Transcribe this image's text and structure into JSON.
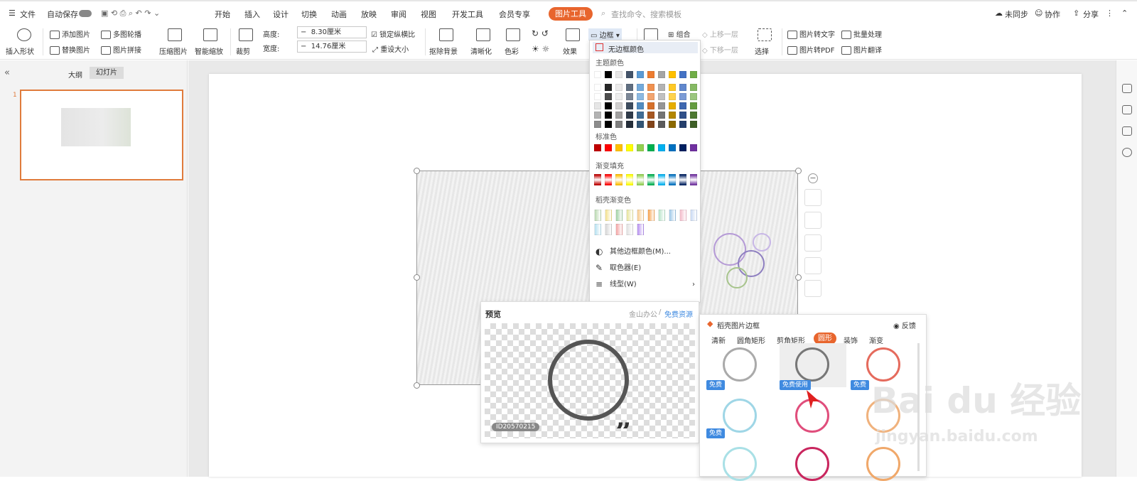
{
  "menu": {
    "file": "文件",
    "autosave": "自动保存"
  },
  "tabs": [
    "开始",
    "插入",
    "设计",
    "切换",
    "动画",
    "放映",
    "审阅",
    "视图",
    "开发工具",
    "会员专享"
  ],
  "active_tab": "图片工具",
  "search_placeholder": "查找命令、搜索模板",
  "top_right": {
    "sync": "未同步",
    "collab": "协作",
    "share": "分享"
  },
  "ribbon": {
    "insert_shape": "插入形状",
    "add_picture": "添加图片",
    "replace_picture": "替换图片",
    "multi_carousel": "多图轮播",
    "picture_collage": "图片拼接",
    "compress": "压缩图片",
    "smart_zoom": "智能缩放",
    "crop": "裁剪",
    "height_label": "高度:",
    "height_value": "8.30厘米",
    "width_label": "宽度:",
    "width_value": "14.76厘米",
    "lock_ratio": "锁定纵横比",
    "reset_size": "重设大小",
    "remove_bg": "抠除背景",
    "sharpen": "清晰化",
    "color": "色彩",
    "effect": "效果",
    "border": "边框",
    "group": "组合",
    "bring_forward": "上移一层",
    "send_backward": "下移一层",
    "select": "选择",
    "pic_to_text": "图片转文字",
    "batch": "批量处理",
    "pic_to_pdf": "图片转PDF",
    "pic_translate": "图片翻译"
  },
  "left_panel": {
    "outline": "大纲",
    "slides": "幻灯片",
    "slide_number": "1"
  },
  "dropdown": {
    "no_border": "无边框颜色",
    "theme_colors": "主题颜色",
    "standard_colors": "标准色",
    "gradient_fill": "渐变填充",
    "docer_gradient": "稻壳渐变色",
    "more_colors": "其他边框颜色(M)...",
    "eyedropper": "取色器(E)",
    "line_style": "线型(W)",
    "theme_row": [
      "#ffffff",
      "#000000",
      "#e7e6e6",
      "#44546a",
      "#5b9bd5",
      "#ed7d31",
      "#a5a5a5",
      "#ffc000",
      "#4472c4",
      "#70ad47"
    ],
    "standard_row": [
      "#c00000",
      "#ff0000",
      "#ffc000",
      "#ffff00",
      "#92d050",
      "#00b050",
      "#00b0f0",
      "#0070c0",
      "#002060",
      "#7030a0"
    ]
  },
  "preview": {
    "title": "预览",
    "brand": "金山办公",
    "sep": "/",
    "free_res": "免费资源",
    "id": "ID20570215"
  },
  "frames": {
    "title": "稻壳图片边框",
    "feedback": "反馈",
    "tabs": [
      "清新",
      "圆角矩形",
      "剪角矩形",
      "圆形",
      "装饰",
      "渐变"
    ],
    "active_tab": "圆形",
    "free": "免费",
    "free_use": "免费使用"
  },
  "watermark": {
    "brand": "Bai  du 经验",
    "url": "jingyan.baidu.com"
  }
}
